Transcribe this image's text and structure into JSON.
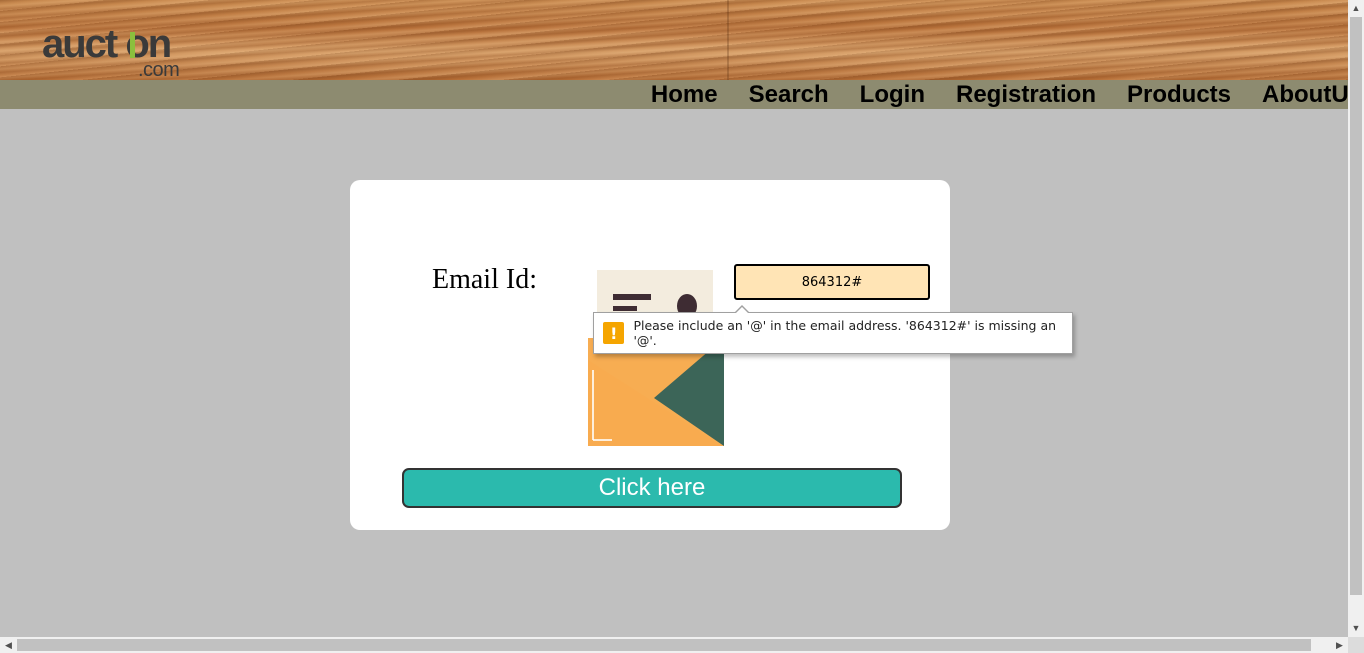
{
  "logo": {
    "main": "auct on",
    "sub": ".com"
  },
  "nav": {
    "items": [
      "Home",
      "Search",
      "Login",
      "Registration",
      "Products",
      "AboutUs"
    ]
  },
  "form": {
    "email_label": "Email Id:",
    "email_value": "864312#",
    "submit_label": "Click here"
  },
  "validation": {
    "message": "Please include an '@' in the email address. '864312#' is missing an '@'.",
    "icon": "warning-icon"
  },
  "colors": {
    "nav_bar": "#8d8b70",
    "input_bg": "#ffe4b5",
    "button_bg": "#2bbaad",
    "page_bg": "#c0c0c0",
    "warning": "#f5a500"
  }
}
